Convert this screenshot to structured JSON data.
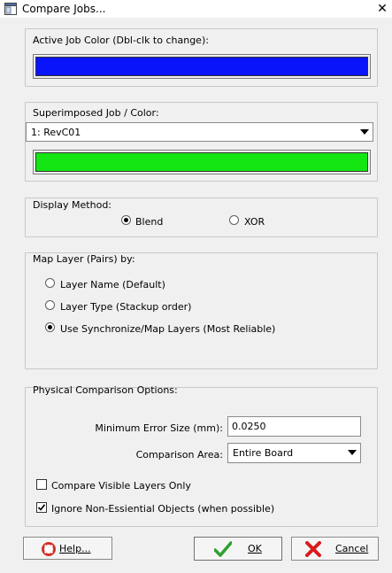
{
  "window": {
    "title": "Compare Jobs...",
    "close_glyph": "✕",
    "icon": "app-window-icon"
  },
  "active_job": {
    "label": "Active Job Color (Dbl-clk to change):",
    "color": "#0a14fa"
  },
  "superimposed": {
    "label": "Superimposed Job / Color:",
    "selected": "1: RevC01",
    "color": "#14e614"
  },
  "display_method": {
    "label": "Display Method:",
    "options": [
      {
        "label": "Blend",
        "checked": true
      },
      {
        "label": "XOR",
        "checked": false
      }
    ]
  },
  "map_layer": {
    "label": "Map Layer (Pairs) by:",
    "options": [
      {
        "label": "Layer Name (Default)",
        "checked": false
      },
      {
        "label": "Layer Type (Stackup order)",
        "checked": false
      },
      {
        "label": "Use Synchronize/Map Layers (Most Reliable)",
        "checked": true
      }
    ]
  },
  "physical": {
    "label": "Physical Comparison Options:",
    "min_error_label": "Minimum Error Size (mm):",
    "min_error_value": "0.0250",
    "area_label": "Comparison Area:",
    "area_selected": "Entire Board",
    "visible_only": {
      "label": "Compare Visible Layers Only",
      "checked": false
    },
    "ignore_non_essential": {
      "label": "Ignore Non-Essiential Objects (when possible)",
      "checked": true
    }
  },
  "buttons": {
    "help": {
      "label": "Help...",
      "icon": "lifebuoy-icon"
    },
    "ok": {
      "label": "OK",
      "icon": "green-check-icon"
    },
    "cancel": {
      "label": "Cancel",
      "icon": "red-x-icon"
    }
  },
  "colors": {
    "check": "#2fa02f",
    "cancel_x": "#d81c1c",
    "lifebuoy": "#e23a2a"
  }
}
